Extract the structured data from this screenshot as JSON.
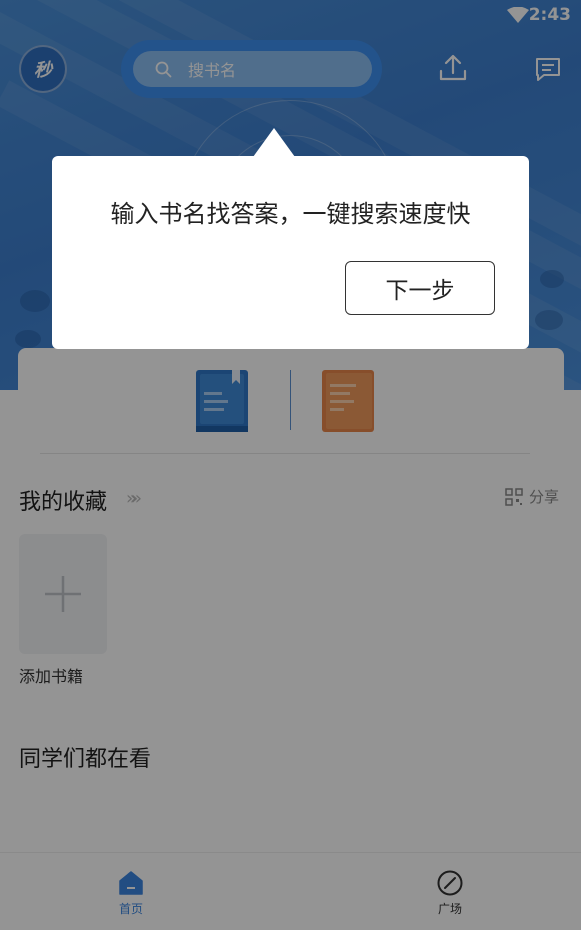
{
  "status_bar": {
    "time": "2:43",
    "wifi_icon": "wifi-icon"
  },
  "header": {
    "logo_text": "秒",
    "search_placeholder": "搜书名",
    "search_icon": "search-icon",
    "upload_icon": "upload-icon",
    "message_icon": "message-icon"
  },
  "quick_tools": [
    {
      "icon": "blue-book-icon",
      "color": "#2f78c8"
    },
    {
      "icon": "orange-notebook-icon",
      "color": "#e9874a"
    }
  ],
  "favorites": {
    "title": "我的收藏",
    "chevrons": "»»",
    "share_label": "分享",
    "add_book_label": "添加书籍"
  },
  "classmates": {
    "title": "同学们都在看"
  },
  "bottom_nav": [
    {
      "label": "首页",
      "icon": "home-icon",
      "active": true
    },
    {
      "label": "广场",
      "icon": "compass-icon",
      "active": false
    }
  ],
  "tooltip": {
    "text": "输入书名找答案，一键搜索速度快",
    "next_label": "下一步"
  },
  "colors": {
    "accent": "#3b86e0",
    "header_blue": "#4a8fd8",
    "overlay": "rgba(0,0,0,0.42)"
  }
}
